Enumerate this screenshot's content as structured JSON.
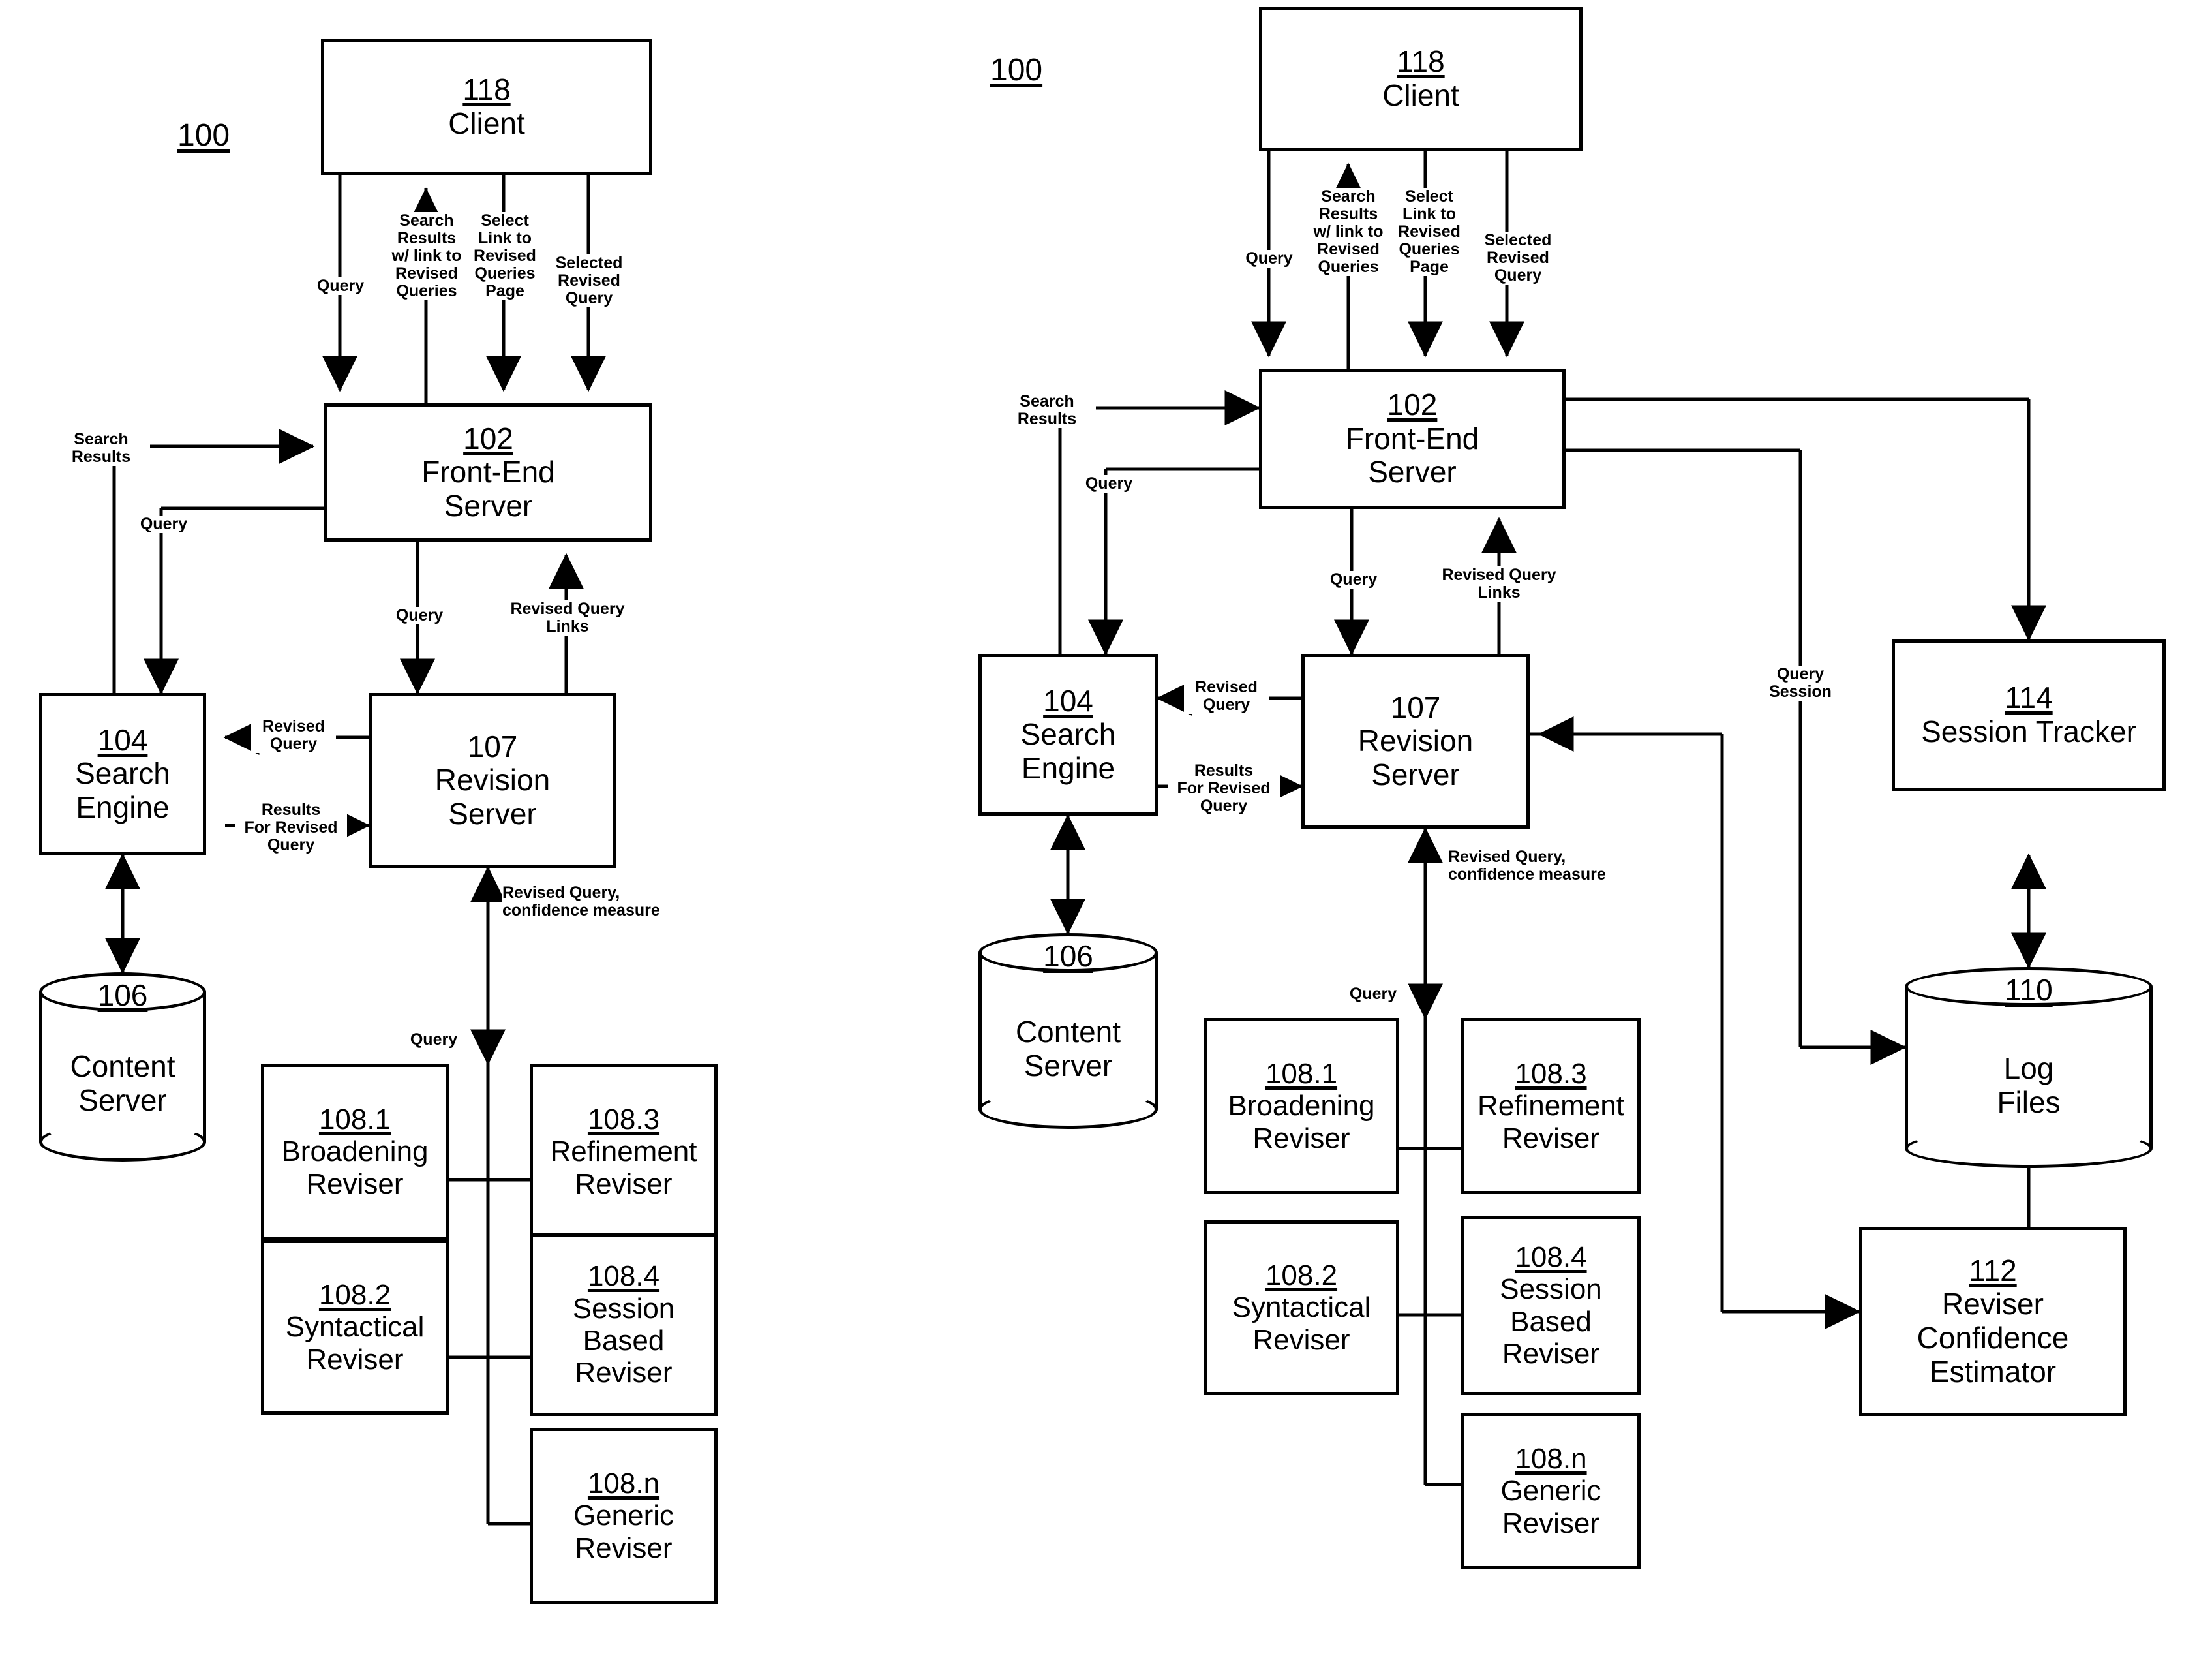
{
  "figures": [
    {
      "id": "left",
      "fignum": "100",
      "nodes": {
        "client": {
          "ref": "118",
          "label": "Client"
        },
        "frontend": {
          "ref": "102",
          "label": "Front-End\nServer"
        },
        "search": {
          "ref": "104",
          "label": "Search\nEngine"
        },
        "revision": {
          "ref": "107",
          "label": "Revision\nServer",
          "ref_underlined": false
        },
        "content": {
          "ref": "106",
          "label": "Content\nServer"
        },
        "broadening": {
          "ref": "108.1",
          "label": "Broadening\nReviser"
        },
        "refinement": {
          "ref": "108.3",
          "label": "Refinement\nReviser"
        },
        "syntactical": {
          "ref": "108.2",
          "label": "Syntactical\nReviser"
        },
        "sessionbased": {
          "ref": "108.4",
          "label": "Session\nBased\nReviser"
        },
        "generic": {
          "ref": "108.n",
          "label": "Generic\nReviser"
        }
      },
      "edge_labels": {
        "query_down": "Query",
        "search_results_links": "Search\nResults\nw/ link to\nRevised\nQueries",
        "select_link": "Select\nLink to\nRevised\nQueries\nPage",
        "selected_revised": "Selected\nRevised\nQuery",
        "search_results_in": "Search\nResults",
        "query_to_search": "Query",
        "query_to_revision": "Query",
        "revised_query_links": "Revised Query\nLinks",
        "revised_query": "Revised\nQuery",
        "results_for_revised": "Results\nFor Revised\nQuery",
        "revised_query_conf": "Revised Query,\nconfidence measure",
        "query_to_revisers": "Query"
      }
    },
    {
      "id": "right",
      "fignum": "100",
      "nodes": {
        "client": {
          "ref": "118",
          "label": "Client"
        },
        "frontend": {
          "ref": "102",
          "label": "Front-End\nServer"
        },
        "search": {
          "ref": "104",
          "label": "Search\nEngine"
        },
        "revision": {
          "ref": "107",
          "label": "Revision\nServer",
          "ref_underlined": false
        },
        "content": {
          "ref": "106",
          "label": "Content\nServer"
        },
        "sessiontracker": {
          "ref": "114",
          "label": "Session Tracker"
        },
        "logfiles": {
          "ref": "110",
          "label": "Log\nFiles"
        },
        "confidence": {
          "ref": "112",
          "label": "Reviser\nConfidence\nEstimator"
        },
        "broadening": {
          "ref": "108.1",
          "label": "Broadening\nReviser"
        },
        "refinement": {
          "ref": "108.3",
          "label": "Refinement\nReviser"
        },
        "syntactical": {
          "ref": "108.2",
          "label": "Syntactical\nReviser"
        },
        "sessionbased": {
          "ref": "108.4",
          "label": "Session\nBased\nReviser"
        },
        "generic": {
          "ref": "108.n",
          "label": "Generic\nReviser"
        }
      },
      "edge_labels": {
        "query_down": "Query",
        "search_results_links": "Search\nResults\nw/ link to\nRevised\nQueries",
        "select_link": "Select\nLink to\nRevised\nQueries\nPage",
        "selected_revised": "Selected\nRevised\nQuery",
        "search_results_in": "Search\nResults",
        "query_to_search": "Query",
        "query_to_revision": "Query",
        "revised_query_links": "Revised Query\nLinks",
        "revised_query": "Revised\nQuery",
        "results_for_revised": "Results\nFor Revised\nQuery",
        "revised_query_conf": "Revised Query,\nconfidence measure",
        "query_to_revisers": "Query",
        "query_session": "Query\nSession"
      }
    }
  ],
  "style": {
    "ink": "#000000",
    "paper": "#ffffff"
  }
}
